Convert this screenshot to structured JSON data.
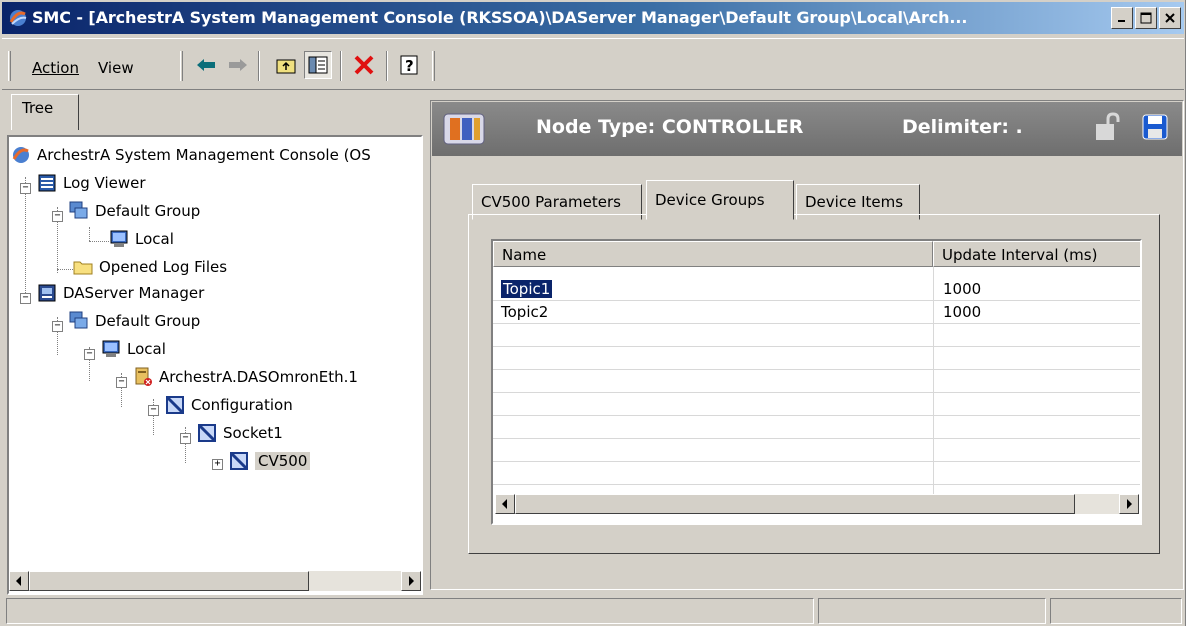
{
  "window": {
    "title": "SMC - [ArchestrA System Management Console (RKSSOA)\\DAServer Manager\\Default Group\\Local\\Arch..."
  },
  "menu": {
    "action_label": "Action",
    "view_label": "View"
  },
  "toolbar": {
    "icons": [
      "back-arrow-icon",
      "forward-arrow-icon",
      "up-one-level-icon",
      "show-hide-tree-icon",
      "delete-icon",
      "help-icon"
    ]
  },
  "left_pane": {
    "tab_label": "Tree",
    "tree": [
      {
        "label": "ArchestrA System Management Console (OS",
        "icon": "smc-icon",
        "level": 0
      },
      {
        "label": "Log Viewer",
        "icon": "log-viewer-icon",
        "level": 1
      },
      {
        "label": "Default Group",
        "icon": "group-icon",
        "level": 2
      },
      {
        "label": "Local",
        "icon": "computer-icon",
        "level": 3
      },
      {
        "label": "Opened Log Files",
        "icon": "folder-icon",
        "level": 2
      },
      {
        "label": "DAServer Manager",
        "icon": "daserver-manager-icon",
        "level": 1
      },
      {
        "label": "Default Group",
        "icon": "group-icon",
        "level": 2
      },
      {
        "label": "Local",
        "icon": "computer-icon",
        "level": 3
      },
      {
        "label": "ArchestrA.DASOmronEth.1",
        "icon": "daserver-icon",
        "level": 4
      },
      {
        "label": "Configuration",
        "icon": "config-icon",
        "level": 5
      },
      {
        "label": "Socket1",
        "icon": "socket-icon",
        "level": 6
      },
      {
        "label": "CV500",
        "icon": "controller-icon",
        "level": 7
      }
    ]
  },
  "right_pane": {
    "node_type": "Node Type: CONTROLLER",
    "delimiter": "Delimiter: .",
    "tabs": [
      {
        "label": "CV500 Parameters",
        "active": false
      },
      {
        "label": "Device Groups",
        "active": true
      },
      {
        "label": "Device Items",
        "active": false
      }
    ],
    "grid": {
      "columns": [
        "Name",
        "Update Interval (ms)"
      ],
      "rows": [
        {
          "name": "Topic1",
          "interval": "1000",
          "selected": true
        },
        {
          "name": "Topic2",
          "interval": "1000",
          "selected": false
        }
      ]
    }
  },
  "colors": {
    "titlebar_start": "#0a246a",
    "titlebar_end": "#a6caf0",
    "chrome": "#d4d0c8",
    "header_gray": "#7a7a7a",
    "selection": "#0a246a"
  }
}
